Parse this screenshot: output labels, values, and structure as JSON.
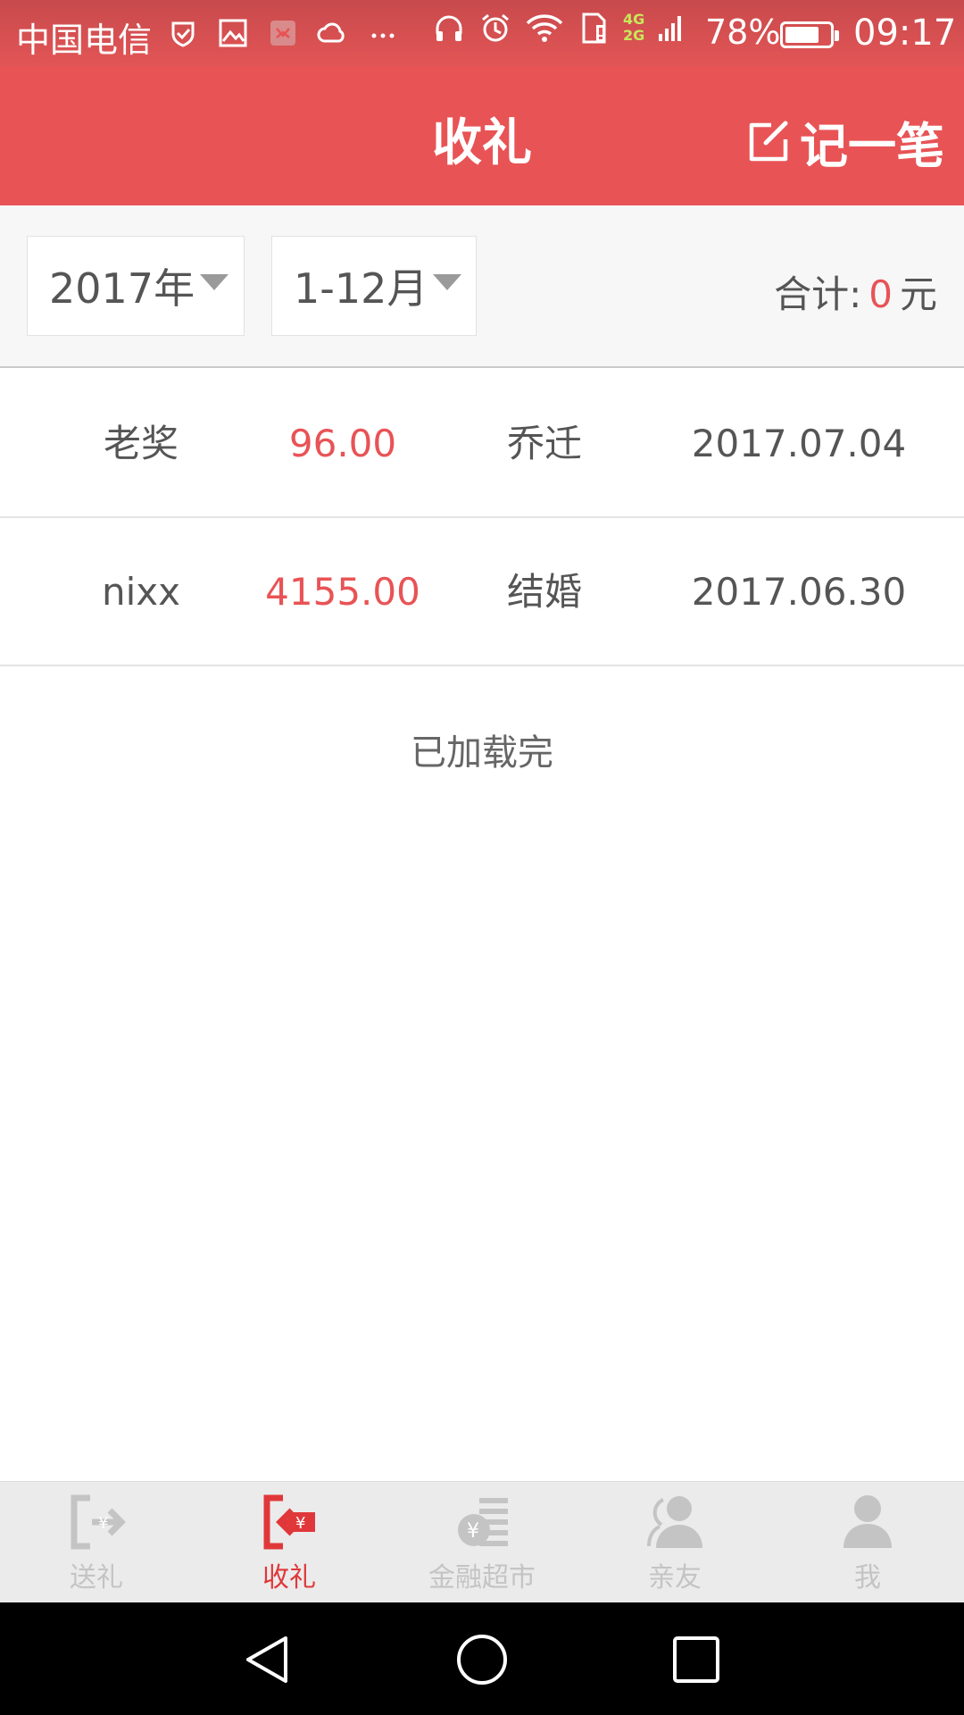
{
  "status_bar": {
    "carrier": "中国电信",
    "network_top": "4G",
    "network_bottom": "2G",
    "battery": "78%",
    "battery_level": 0.78,
    "time": "09:17"
  },
  "header": {
    "title": "收礼",
    "add_label": "记一笔"
  },
  "filters": {
    "year": "2017年",
    "month_range": "1-12月",
    "total_label": "合计:",
    "total_value": "0",
    "total_unit": "元"
  },
  "records": [
    {
      "name": "老奖",
      "amount": "96.00",
      "event": "乔迁",
      "date": "2017.07.04"
    },
    {
      "name": "nixx",
      "amount": "4155.00",
      "event": "结婚",
      "date": "2017.06.30"
    }
  ],
  "list_footer": "已加载完",
  "tabs": [
    {
      "label": "送礼",
      "icon": "send-gift-icon",
      "active": false
    },
    {
      "label": "收礼",
      "icon": "receive-gift-icon",
      "active": true
    },
    {
      "label": "金融超市",
      "icon": "finance-market-icon",
      "active": false
    },
    {
      "label": "亲友",
      "icon": "friends-icon",
      "active": false
    },
    {
      "label": "我",
      "icon": "profile-icon",
      "active": false
    }
  ],
  "colors": {
    "primary": "#e85355",
    "active_tab": "#e0383a",
    "inactive_tab": "#c4c4c4"
  }
}
